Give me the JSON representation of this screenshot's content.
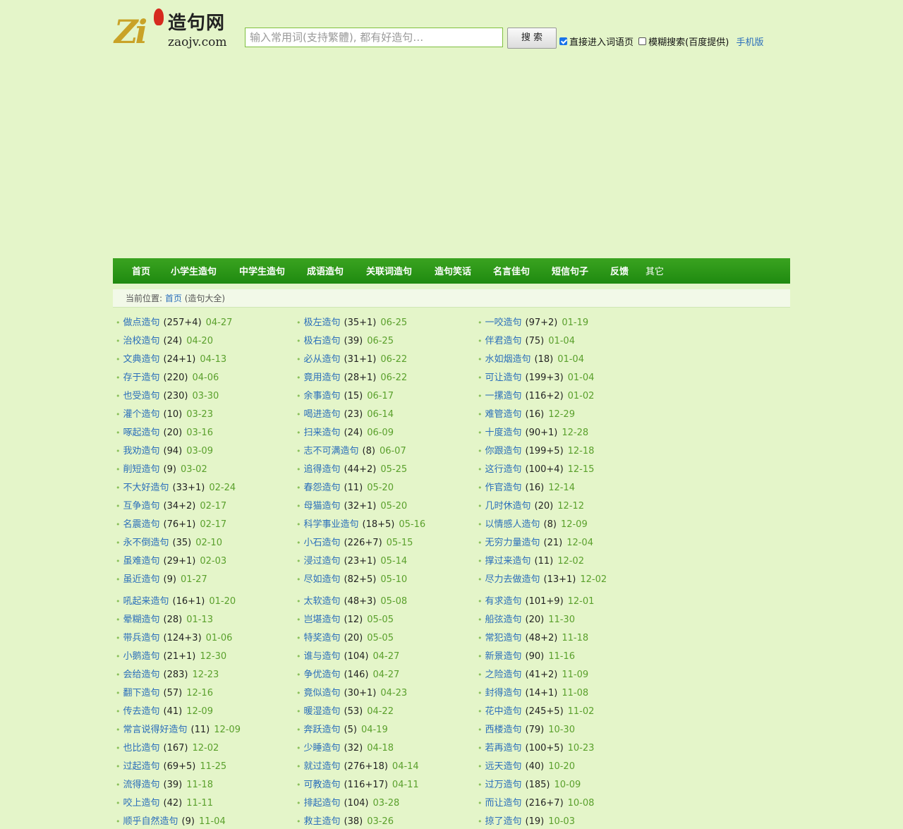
{
  "site": {
    "logo_zi": "Zi",
    "logo_cn": "造句网",
    "logo_en": "zaojv.com"
  },
  "search": {
    "placeholder": "输入常用词(支持繁體), 都有好造句…",
    "button": "搜 索",
    "opt_direct": "直接进入词语页",
    "opt_direct_checked": true,
    "opt_fuzzy": "模糊搜索(百度提供)",
    "opt_fuzzy_checked": false,
    "mobile": "手机版"
  },
  "nav": [
    "首页",
    "小学生造句",
    "中学生造句",
    "成语造句",
    "关联词造句",
    "造句笑话",
    "名言佳句",
    "短信句子",
    "反馈",
    "其它"
  ],
  "breadcrumb": {
    "label": "当前位置: ",
    "home": "首页",
    "current": " (造句大全)"
  },
  "columns": [
    [
      [
        "做点造句",
        "(257+4)",
        "04-27"
      ],
      [
        "治校造句",
        "(24)",
        "04-20"
      ],
      [
        "文典造句",
        "(24+1)",
        "04-13"
      ],
      [
        "存于造句",
        "(220)",
        "04-06"
      ],
      [
        "也受造句",
        "(230)",
        "03-30"
      ],
      [
        "灌个造句",
        "(10)",
        "03-23"
      ],
      [
        "啄起造句",
        "(20)",
        "03-16"
      ],
      [
        "我劝造句",
        "(94)",
        "03-09"
      ],
      [
        "削短造句",
        "(9)",
        "03-02"
      ],
      [
        "不大好造句",
        "(33+1)",
        "02-24"
      ],
      [
        "互争造句",
        "(34+2)",
        "02-17"
      ],
      [
        "名震造句",
        "(76+1)",
        "02-17"
      ],
      [
        "永不倒造句",
        "(35)",
        "02-10"
      ],
      [
        "虽难造句",
        "(29+1)",
        "02-03"
      ],
      [
        "虽近造句",
        "(9)",
        "01-27"
      ],
      [
        "吼起来造句",
        "(16+1)",
        "01-20"
      ],
      [
        "晕糊造句",
        "(28)",
        "01-13"
      ],
      [
        "带兵造句",
        "(124+3)",
        "01-06"
      ],
      [
        "小鹅造句",
        "(21+1)",
        "12-30"
      ],
      [
        "会给造句",
        "(283)",
        "12-23"
      ],
      [
        "翻下造句",
        "(57)",
        "12-16"
      ],
      [
        "传去造句",
        "(41)",
        "12-09"
      ],
      [
        "常言说得好造句",
        "(11)",
        "12-09"
      ],
      [
        "也比造句",
        "(167)",
        "12-02"
      ],
      [
        "过起造句",
        "(69+5)",
        "11-25"
      ],
      [
        "流得造句",
        "(39)",
        "11-18"
      ],
      [
        "咬上造句",
        "(42)",
        "11-11"
      ],
      [
        "顺乎自然造句",
        "(9)",
        "11-04"
      ]
    ],
    [
      [
        "极左造句",
        "(35+1)",
        "06-25"
      ],
      [
        "极右造句",
        "(39)",
        "06-25"
      ],
      [
        "必从造句",
        "(31+1)",
        "06-22"
      ],
      [
        "竟用造句",
        "(28+1)",
        "06-22"
      ],
      [
        "余事造句",
        "(15)",
        "06-17"
      ],
      [
        "喝进造句",
        "(23)",
        "06-14"
      ],
      [
        "扫来造句",
        "(24)",
        "06-09"
      ],
      [
        "志不可满造句",
        "(8)",
        "06-07"
      ],
      [
        "追得造句",
        "(44+2)",
        "05-25"
      ],
      [
        "春怨造句",
        "(11)",
        "05-20"
      ],
      [
        "母猫造句",
        "(32+1)",
        "05-20"
      ],
      [
        "科学事业造句",
        "(18+5)",
        "05-16"
      ],
      [
        "小石造句",
        "(226+7)",
        "05-15"
      ],
      [
        "浸过造句",
        "(23+1)",
        "05-14"
      ],
      [
        "尽如造句",
        "(82+5)",
        "05-10"
      ],
      [
        "太软造句",
        "(48+3)",
        "05-08"
      ],
      [
        "岂堪造句",
        "(12)",
        "05-05"
      ],
      [
        "特奖造句",
        "(20)",
        "05-05"
      ],
      [
        "谁与造句",
        "(104)",
        "04-27"
      ],
      [
        "争优造句",
        "(146)",
        "04-27"
      ],
      [
        "竟似造句",
        "(30+1)",
        "04-23"
      ],
      [
        "暖湿造句",
        "(53)",
        "04-22"
      ],
      [
        "奔跃造句",
        "(5)",
        "04-19"
      ],
      [
        "少睡造句",
        "(32)",
        "04-18"
      ],
      [
        "就过造句",
        "(276+18)",
        "04-14"
      ],
      [
        "可教造句",
        "(116+17)",
        "04-11"
      ],
      [
        "排起造句",
        "(104)",
        "03-28"
      ],
      [
        "救主造句",
        "(38)",
        "03-26"
      ]
    ],
    [
      [
        "一咬造句",
        "(97+2)",
        "01-19"
      ],
      [
        "伴君造句",
        "(75)",
        "01-04"
      ],
      [
        "水如烟造句",
        "(18)",
        "01-04"
      ],
      [
        "可让造句",
        "(199+3)",
        "01-04"
      ],
      [
        "一摞造句",
        "(116+2)",
        "01-02"
      ],
      [
        "难管造句",
        "(16)",
        "12-29"
      ],
      [
        "十度造句",
        "(90+1)",
        "12-28"
      ],
      [
        "你跟造句",
        "(199+5)",
        "12-18"
      ],
      [
        "这行造句",
        "(100+4)",
        "12-15"
      ],
      [
        "作官造句",
        "(16)",
        "12-14"
      ],
      [
        "几时休造句",
        "(20)",
        "12-12"
      ],
      [
        "以情感人造句",
        "(8)",
        "12-09"
      ],
      [
        "无穷力量造句",
        "(21)",
        "12-04"
      ],
      [
        "撑过来造句",
        "(11)",
        "12-02"
      ],
      [
        "尽力去做造句",
        "(13+1)",
        "12-02"
      ],
      [
        "有求造句",
        "(101+9)",
        "12-01"
      ],
      [
        "船弦造句",
        "(20)",
        "11-30"
      ],
      [
        "常犯造句",
        "(48+2)",
        "11-18"
      ],
      [
        "新景造句",
        "(90)",
        "11-16"
      ],
      [
        "之险造句",
        "(41+2)",
        "11-09"
      ],
      [
        "封得造句",
        "(14+1)",
        "11-08"
      ],
      [
        "花中造句",
        "(245+5)",
        "11-02"
      ],
      [
        "西楼造句",
        "(79)",
        "10-30"
      ],
      [
        "若再造句",
        "(100+5)",
        "10-23"
      ],
      [
        "远天造句",
        "(40)",
        "10-20"
      ],
      [
        "过万造句",
        "(185)",
        "10-09"
      ],
      [
        "而让造句",
        "(216+7)",
        "10-08"
      ],
      [
        "掠了造句",
        "(19)",
        "10-03"
      ]
    ]
  ]
}
